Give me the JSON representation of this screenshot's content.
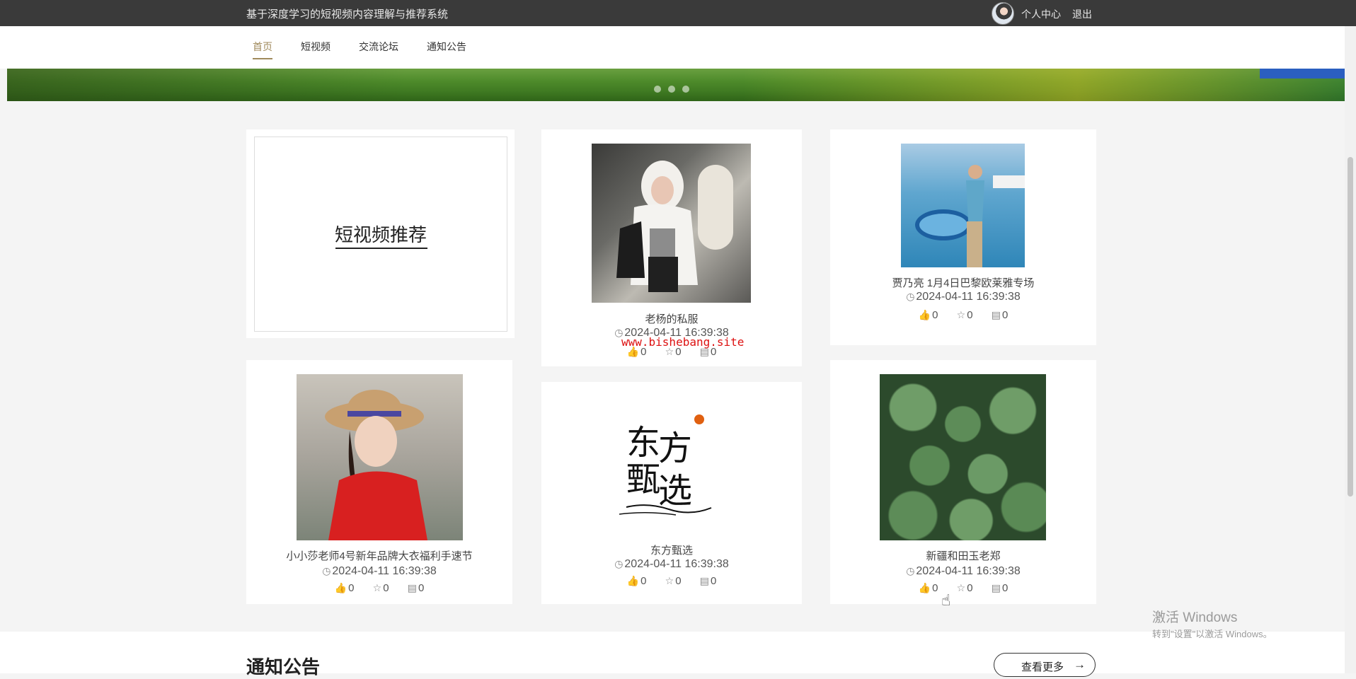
{
  "header": {
    "title": "基于深度学习的短视频内容理解与推荐系统",
    "user_center": "个人中心",
    "logout": "退出"
  },
  "nav": {
    "items": [
      "首页",
      "短视频",
      "交流论坛",
      "通知公告"
    ],
    "active": "首页"
  },
  "banner": {
    "slides": 3
  },
  "recommend": {
    "title": "短视频推荐"
  },
  "videos": [
    {
      "title": "老杨的私服",
      "time": "2024-04-11 16:39:38",
      "likes": "0",
      "favorites": "0",
      "comments": "0"
    },
    {
      "title": "贾乃亮 1月4日巴黎欧莱雅专场",
      "time": "2024-04-11 16:39:38",
      "likes": "0",
      "favorites": "0",
      "comments": "0"
    },
    {
      "title": "小小莎老师4号新年品牌大衣福利手速节",
      "time": "2024-04-11 16:39:38",
      "likes": "0",
      "favorites": "0",
      "comments": "0"
    },
    {
      "title": "东方甄选",
      "time": "2024-04-11 16:39:38",
      "likes": "0",
      "favorites": "0",
      "comments": "0",
      "logo_text": "东方甄选"
    },
    {
      "title": "新疆和田玉老郑",
      "time": "2024-04-11 16:39:38",
      "likes": "0",
      "favorites": "0",
      "comments": "0"
    }
  ],
  "watermark": "www.bishebang.site",
  "notice": {
    "title": "通知公告",
    "more": "查看更多",
    "more_arrow": "→"
  },
  "os_watermark": {
    "line1": "激活 Windows",
    "line2": "转到\"设置\"以激活 Windows。"
  },
  "colors": {
    "topbar": "#3a3a3a",
    "accent": "#a08a5c",
    "watermark": "#dd1111"
  }
}
